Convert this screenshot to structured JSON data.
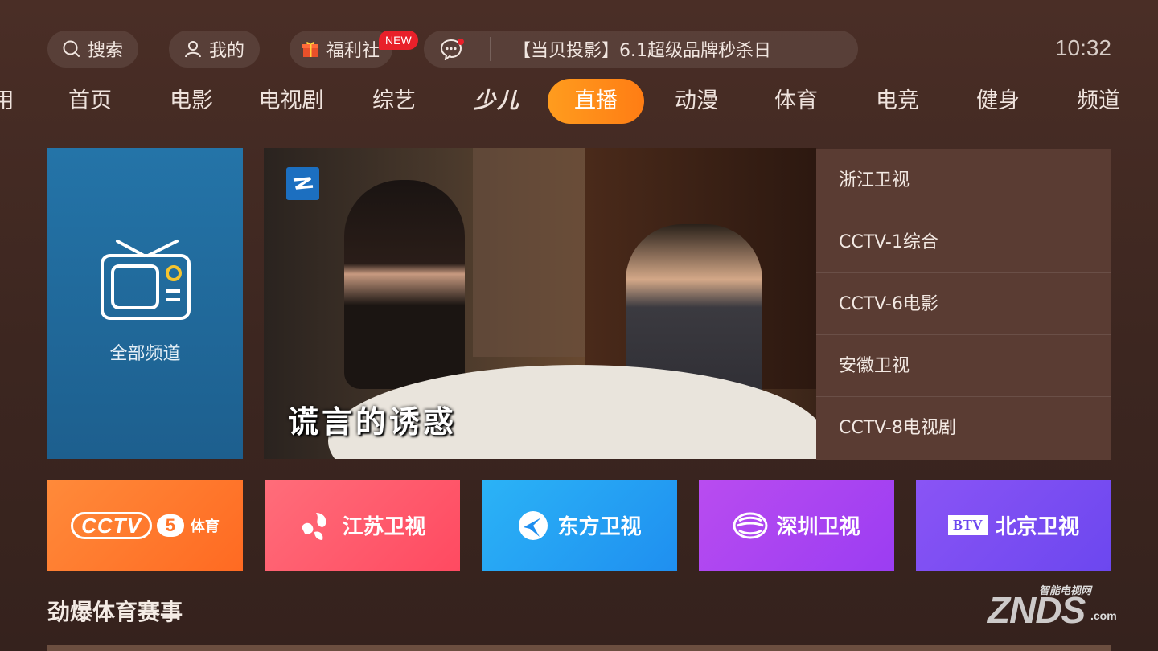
{
  "topbar": {
    "search_label": "搜索",
    "mine_label": "我的",
    "welfare_label": "福利社",
    "new_badge": "NEW",
    "message_text": "【当贝投影】6.1超级品牌秒杀日",
    "time": "10:32"
  },
  "tabs": [
    {
      "label": "用"
    },
    {
      "label": "首页"
    },
    {
      "label": "电影"
    },
    {
      "label": "电视剧"
    },
    {
      "label": "综艺"
    },
    {
      "label": "少儿"
    },
    {
      "label": "直播",
      "active": true
    },
    {
      "label": "动漫"
    },
    {
      "label": "体育"
    },
    {
      "label": "电竞"
    },
    {
      "label": "健身"
    },
    {
      "label": "频道"
    }
  ],
  "all_channels_label": "全部频道",
  "video": {
    "caption": "谎言的诱惑"
  },
  "channel_list": [
    {
      "name": "浙江卫视"
    },
    {
      "name": "CCTV-1综合"
    },
    {
      "name": "CCTV-6电影"
    },
    {
      "name": "安徽卫视"
    },
    {
      "name": "CCTV-8电视剧"
    }
  ],
  "tiles": {
    "cctv5": {
      "mark": "CCTV",
      "num": "5",
      "suffix": "体育"
    },
    "jiangsu": {
      "name": "江苏卫视"
    },
    "dongfang": {
      "name": "东方卫视"
    },
    "shenzhen": {
      "name": "深圳卫视"
    },
    "beijing": {
      "box": "BTV",
      "name": "北京卫视"
    }
  },
  "section_title": "劲爆体育赛事",
  "watermark": {
    "small": "智能电视网",
    "big": "ZNDS",
    "suffix": ".com"
  },
  "colors": {
    "active_tab": "#ff8a1a",
    "all_channels_bg": "#2272a6",
    "channel_list_bg": "#5a3c33",
    "tile_cctv5": "#ff7a2e",
    "tile_jiangsu": "#ff5a6c",
    "tile_dongfang": "#249ff3",
    "tile_shenzhen": "#a944f1",
    "tile_beijing": "#7a4df2"
  }
}
